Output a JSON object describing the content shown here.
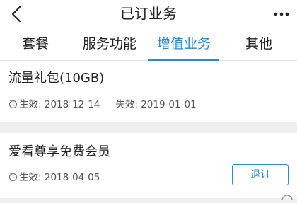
{
  "header": {
    "title": "已订业务",
    "back_icon": "chevron-left-icon",
    "more_icon": "more-dots-icon"
  },
  "tabs": [
    {
      "label": "套餐",
      "active": false
    },
    {
      "label": "服务功能",
      "active": false
    },
    {
      "label": "增值业务",
      "active": true
    },
    {
      "label": "其他",
      "active": false
    }
  ],
  "subscriptions": [
    {
      "name": "流量礼包(10GB)",
      "effective_label": "生效:",
      "effective_date": "2018-12-14",
      "expiry_label": "失效:",
      "expiry_date": "2019-01-01"
    },
    {
      "name": "爱看尊享免费会员",
      "effective_label": "生效:",
      "effective_date": "2018-04-05",
      "unsubscribe_label": "退订"
    }
  ],
  "colors": {
    "accent": "#2a88d8",
    "background": "#efefef"
  }
}
